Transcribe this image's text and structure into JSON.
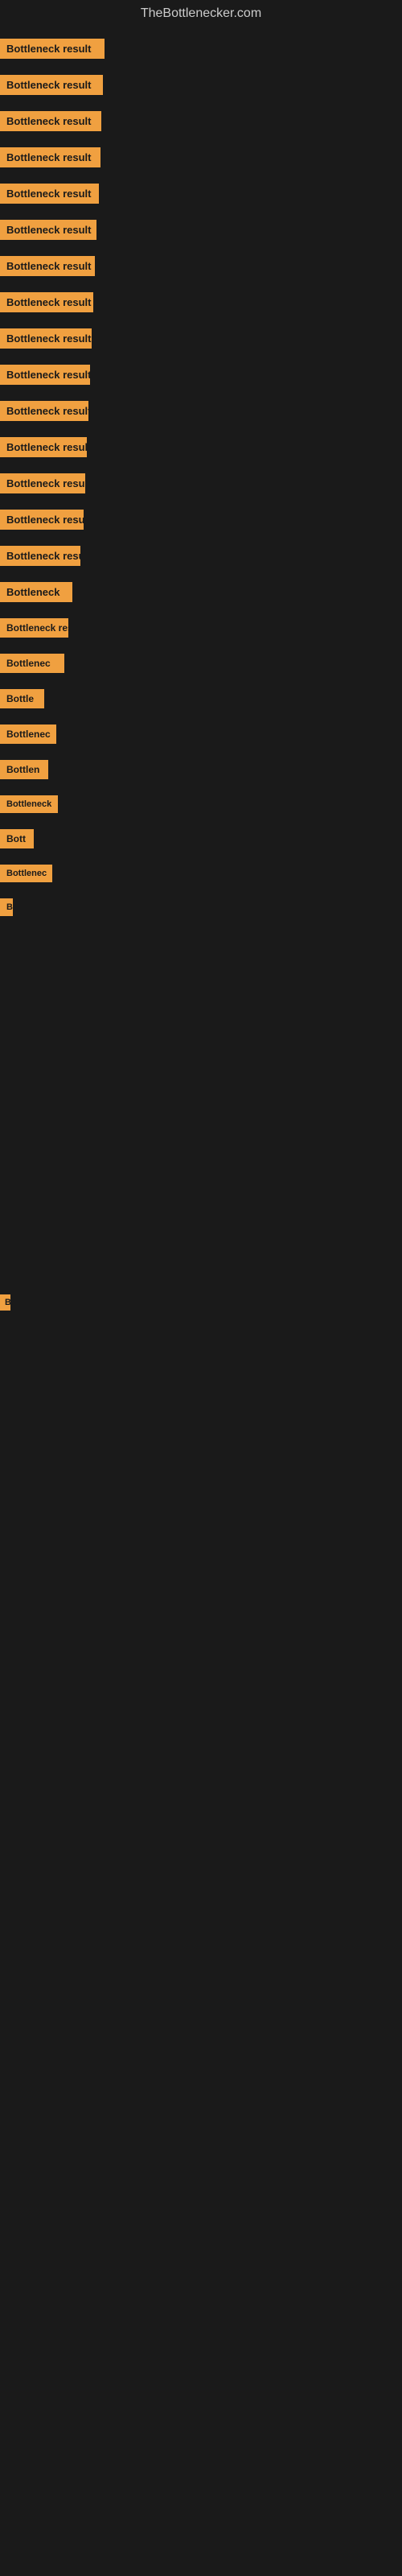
{
  "site": {
    "title": "TheBottlenecker.com"
  },
  "items": [
    {
      "label": "Bottleneck result",
      "visible_width": 130
    },
    {
      "label": "Bottleneck result",
      "visible_width": 128
    },
    {
      "label": "Bottleneck result",
      "visible_width": 126
    },
    {
      "label": "Bottleneck result",
      "visible_width": 125
    },
    {
      "label": "Bottleneck result",
      "visible_width": 123
    },
    {
      "label": "Bottleneck result",
      "visible_width": 120
    },
    {
      "label": "Bottleneck result",
      "visible_width": 118
    },
    {
      "label": "Bottleneck result",
      "visible_width": 116
    },
    {
      "label": "Bottleneck result",
      "visible_width": 114
    },
    {
      "label": "Bottleneck result",
      "visible_width": 112
    },
    {
      "label": "Bottleneck result",
      "visible_width": 110
    },
    {
      "label": "Bottleneck result",
      "visible_width": 108
    },
    {
      "label": "Bottleneck result",
      "visible_width": 106
    },
    {
      "label": "Bottleneck result",
      "visible_width": 104
    },
    {
      "label": "Bottleneck resu",
      "visible_width": 100
    },
    {
      "label": "Bottleneck",
      "visible_width": 90
    },
    {
      "label": "Bottleneck res",
      "visible_width": 85
    },
    {
      "label": "Bottlenec",
      "visible_width": 80
    },
    {
      "label": "Bottle",
      "visible_width": 55
    },
    {
      "label": "Bottlenec",
      "visible_width": 70
    },
    {
      "label": "Bottlen",
      "visible_width": 60
    },
    {
      "label": "Bottleneck",
      "visible_width": 72
    },
    {
      "label": "Bott",
      "visible_width": 42
    },
    {
      "label": "Bottlenec",
      "visible_width": 65
    },
    {
      "label": "B",
      "visible_width": 12
    }
  ],
  "late_items": [
    {
      "label": "B",
      "visible_width": 13
    }
  ],
  "colors": {
    "badge_bg": "#f0a040",
    "body_bg": "#1a1a1a",
    "title_color": "#cccccc"
  }
}
